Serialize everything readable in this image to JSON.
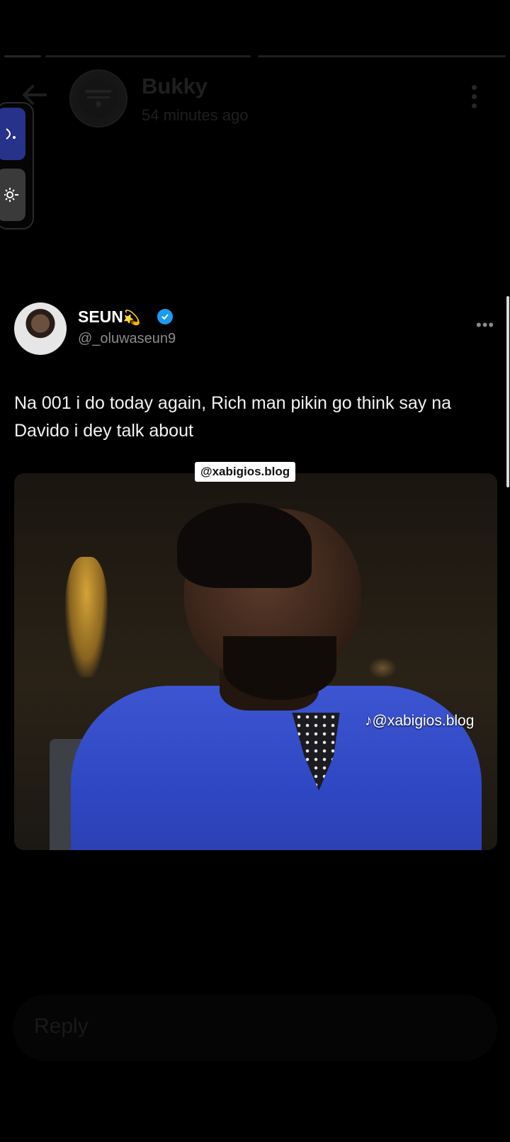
{
  "story": {
    "user_name": "Bukky",
    "time_ago": "54 minutes ago",
    "avatar_text": "WELCOME TO THE PERFUME..."
  },
  "tweet": {
    "author_name": "SEUN",
    "author_emoji": "💫",
    "handle": "@_oluwaseun9",
    "text": "Na 001 i do today again, Rich man pikin go think say na Davido i dey talk about",
    "more": "•••"
  },
  "media": {
    "watermark_top": "@xabigios.blog",
    "watermark_bottom": "@xabigios.blog"
  },
  "reply": {
    "placeholder": "Reply"
  },
  "colors": {
    "background": "#000000",
    "verified": "#1d9bf0",
    "tool_active": "#27328a"
  },
  "icons": [
    "back-arrow-icon",
    "more-vertical-icon",
    "verified-badge-icon",
    "tiktok-icon",
    "edit-tool-icon",
    "brightness-icon"
  ]
}
